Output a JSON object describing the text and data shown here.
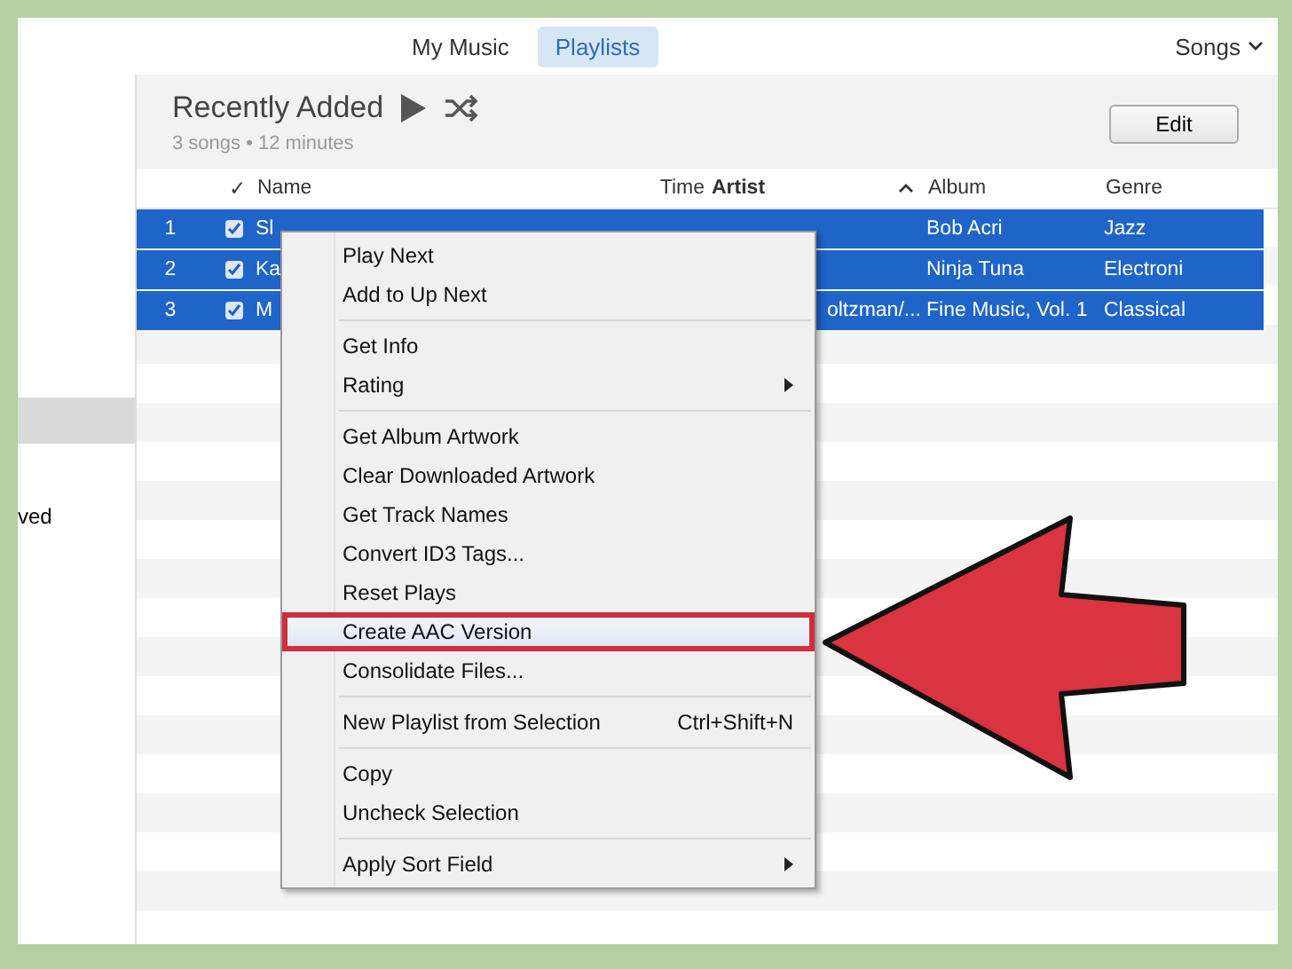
{
  "top_bar": {
    "tabs": [
      {
        "label": "My Music",
        "selected": false
      },
      {
        "label": "Playlists",
        "selected": true
      }
    ],
    "view_menu": "Songs"
  },
  "sidebar": {
    "items": [
      {
        "selected": true
      },
      {
        "label": "ved",
        "selected": false
      }
    ]
  },
  "playlist": {
    "title": "Recently Added",
    "summary": "3 songs • 12 minutes",
    "edit_button": "Edit"
  },
  "table": {
    "columns": [
      {
        "label": "✓",
        "sorted": false
      },
      {
        "label": "Name",
        "sorted": false
      },
      {
        "label": "Time",
        "sorted": false
      },
      {
        "label": "Artist",
        "sorted": true
      },
      {
        "label": "Album",
        "sorted": false
      },
      {
        "label": "Genre",
        "sorted": false
      }
    ],
    "rows": [
      {
        "selected": true,
        "number": "1",
        "checked": true,
        "name": "Sl",
        "artist": "",
        "album": "Bob Acri",
        "genre": "Jazz"
      },
      {
        "selected": true,
        "number": "2",
        "checked": true,
        "name": "Ka",
        "artist": "",
        "album": "Ninja Tuna",
        "genre": "Electroni"
      },
      {
        "selected": true,
        "number": "3",
        "checked": true,
        "name": "M",
        "artist": "oltzman/...",
        "album": "Fine Music, Vol. 1",
        "genre": "Classical"
      }
    ]
  },
  "context_menu": {
    "groups": [
      [
        {
          "label": "Play Next"
        },
        {
          "label": "Add to Up Next"
        }
      ],
      [
        {
          "label": "Get Info"
        },
        {
          "label": "Rating",
          "submenu": true
        }
      ],
      [
        {
          "label": "Get Album Artwork"
        },
        {
          "label": "Clear Downloaded Artwork"
        },
        {
          "label": "Get Track Names"
        },
        {
          "label": "Convert ID3 Tags..."
        },
        {
          "label": "Reset Plays"
        },
        {
          "label": "Create AAC Version",
          "highlighted": true
        },
        {
          "label": "Consolidate Files..."
        }
      ],
      [
        {
          "label": "New Playlist from Selection",
          "shortcut": "Ctrl+Shift+N"
        }
      ],
      [
        {
          "label": "Copy"
        },
        {
          "label": "Uncheck Selection"
        }
      ],
      [
        {
          "label": "Apply Sort Field",
          "submenu": true
        }
      ]
    ]
  }
}
